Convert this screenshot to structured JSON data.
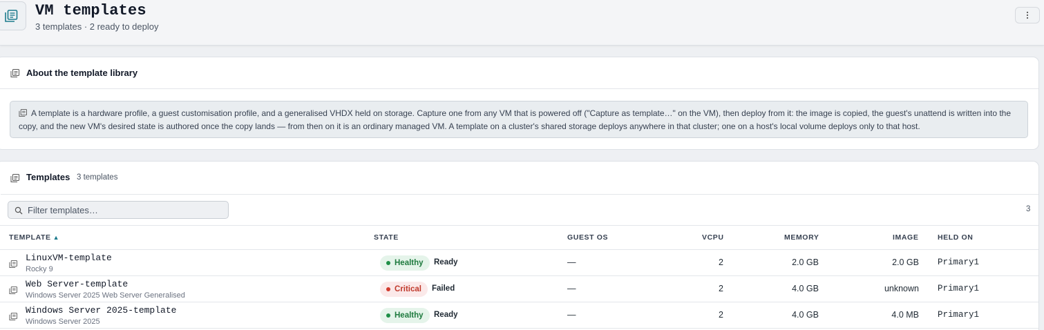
{
  "header": {
    "title": "VM templates",
    "subtitle": "3 templates · 2 ready to deploy",
    "menu_icon": "kebab-icon"
  },
  "about": {
    "title": "About the template library",
    "text": "A template is a hardware profile, a guest customisation profile, and a generalised VHDX held on storage. Capture one from any VM that is powered off (\"Capture as template…\" on the VM), then deploy from it: the image is copied, the guest's unattend is written into the copy, and the new VM's desired state is authored once the copy lands — from then on it is an ordinary managed VM. A template on a cluster's shared storage deploys anywhere in that cluster; one on a host's local volume deploys only to that host."
  },
  "templates": {
    "title": "Templates",
    "count_label": "3 templates",
    "filter_placeholder": "Filter templates…",
    "row_count": "3",
    "columns": {
      "template": "TEMPLATE",
      "state": "STATE",
      "guest_os": "GUEST OS",
      "vcpu": "VCPU",
      "memory": "MEMORY",
      "image": "IMAGE",
      "held_on": "HELD ON"
    },
    "rows": [
      {
        "name": "LinuxVM-template",
        "os": "Rocky 9",
        "health": "Healthy",
        "state": "Ready",
        "guest_os": "—",
        "vcpu": "2",
        "memory": "2.0 GB",
        "image": "2.0 GB",
        "held_on": "Primary1"
      },
      {
        "name": "Web Server-template",
        "os": "Windows Server 2025 Web Server Generalised",
        "health": "Critical",
        "state": "Failed",
        "guest_os": "—",
        "vcpu": "2",
        "memory": "4.0 GB",
        "image": "unknown",
        "held_on": "Primary1"
      },
      {
        "name": "Windows Server 2025-template",
        "os": "Windows Server 2025",
        "health": "Healthy",
        "state": "Ready",
        "guest_os": "—",
        "vcpu": "2",
        "memory": "4.0 GB",
        "image": "4.0 MB",
        "held_on": "Primary1"
      }
    ]
  },
  "colors": {
    "accent": "#1b7a8c",
    "healthy": "#1e8f47",
    "critical": "#d23b2f"
  }
}
